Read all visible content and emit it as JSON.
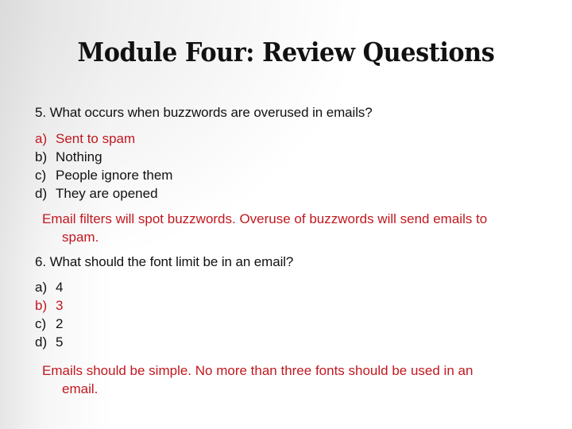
{
  "slide": {
    "title": "Module Four: Review Questions",
    "accent_color": "#c0181f",
    "questions": [
      {
        "prompt": "5. What occurs when buzzwords are overused in emails?",
        "options": [
          {
            "letter": "a)",
            "text": "Sent to spam",
            "correct": true
          },
          {
            "letter": "b)",
            "text": "Nothing",
            "correct": false
          },
          {
            "letter": "c)",
            "text": "People ignore them",
            "correct": false
          },
          {
            "letter": "d)",
            "text": "They are opened",
            "correct": false
          }
        ],
        "explanation_line1": "Email filters will spot buzzwords. Overuse of buzzwords will send emails to",
        "explanation_line2": "spam."
      },
      {
        "prompt": "6. What should the font limit be in an email?",
        "options": [
          {
            "letter": "a)",
            "text": "4",
            "correct": false
          },
          {
            "letter": "b)",
            "text": "3",
            "correct": true
          },
          {
            "letter": "c)",
            "text": "2",
            "correct": false
          },
          {
            "letter": "d)",
            "text": "5",
            "correct": false
          }
        ],
        "explanation_line1": "Emails should be simple. No more than three fonts should be used in an",
        "explanation_line2": "email."
      }
    ]
  }
}
